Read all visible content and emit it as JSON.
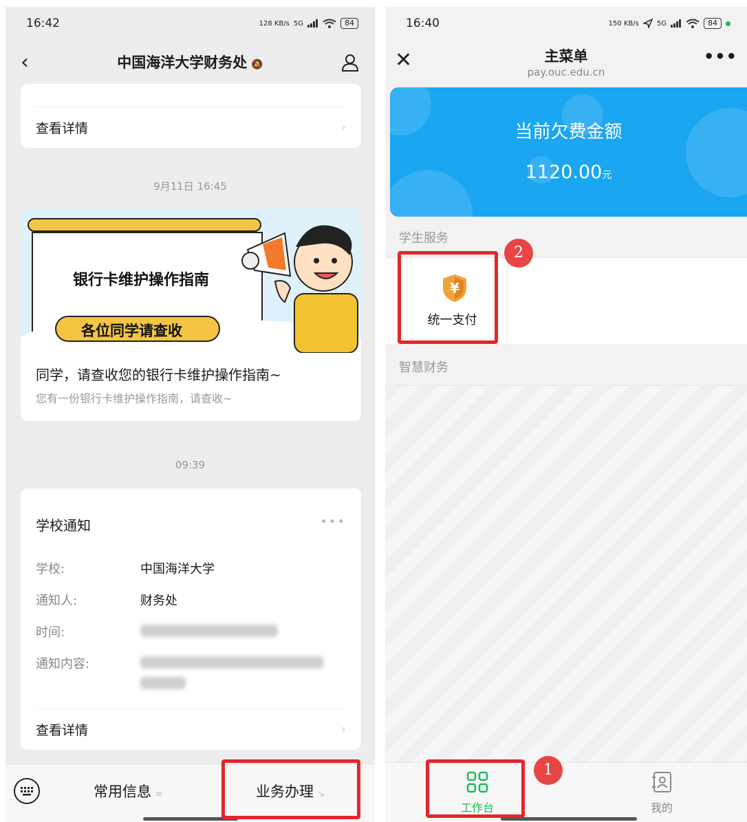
{
  "left": {
    "status": {
      "time": "16:42",
      "speed": "128 KB/s",
      "net": "5G",
      "battery": "84"
    },
    "nav": {
      "title": "中国海洋大学财务处"
    },
    "top_card": {
      "detail": "查看详情"
    },
    "timestamp1": "9月11日 16:45",
    "news": {
      "banner_title": "银行卡维护操作指南",
      "banner_subtitle": "各位同学请查收",
      "title": "同学，请查收您的银行卡维护操作指南~",
      "sub": "您有一份银行卡维护操作指南，请查收~"
    },
    "timestamp2": "09:39",
    "notice": {
      "title": "学校通知",
      "more": "•••",
      "rows": [
        {
          "key": "学校:",
          "val": "中国海洋大学"
        },
        {
          "key": "通知人:",
          "val": "财务处"
        },
        {
          "key": "时间:",
          "val": ""
        },
        {
          "key": "通知内容:",
          "val": ""
        }
      ],
      "detail": "查看详情"
    },
    "menu": {
      "item1": "常用信息",
      "item2": "业务办理"
    }
  },
  "right": {
    "status": {
      "time": "16:40",
      "speed": "150 KB/s",
      "net": "5G",
      "battery": "84"
    },
    "nav": {
      "title": "主菜单",
      "subtitle": "pay.ouc.edu.cn",
      "more": "•••"
    },
    "hero": {
      "label": "当前欠费金额",
      "amount": "1120.00",
      "unit": "元"
    },
    "section1": "学生服务",
    "service": {
      "label": "统一支付",
      "icon": "yen-shield-icon"
    },
    "section2": "智慧财务",
    "tabs": {
      "tab1": "工作台",
      "tab2": "我的"
    }
  },
  "annotations": {
    "badge1": "1",
    "badge2": "2",
    "highlight_color": "#e4262a"
  }
}
